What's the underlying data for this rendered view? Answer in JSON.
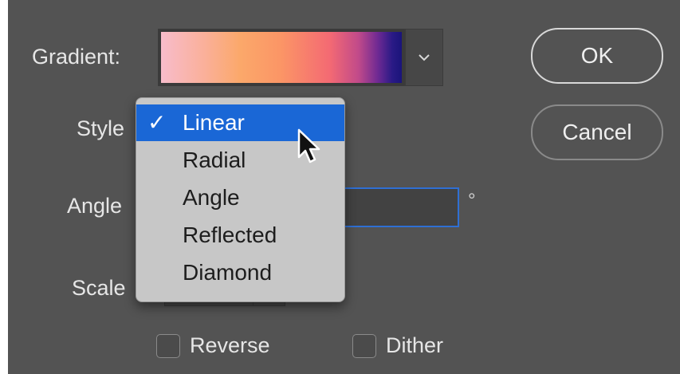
{
  "labels": {
    "gradient": "Gradient:",
    "style": "Style",
    "angle": "Angle",
    "scale": "Scale"
  },
  "buttons": {
    "ok": "OK",
    "cancel": "Cancel"
  },
  "angle_unit": "°",
  "style_menu": {
    "selected": "Linear",
    "check_mark": "✓",
    "items": [
      "Linear",
      "Radial",
      "Angle",
      "Reflected",
      "Diamond"
    ]
  },
  "checkboxes": {
    "reverse": "Reverse",
    "dither": "Dither"
  },
  "colors": {
    "dialog_bg": "#535353",
    "selection_blue": "#1a67d6",
    "focus_blue": "#2f6fd3",
    "menu_bg": "#c7c7c7"
  }
}
